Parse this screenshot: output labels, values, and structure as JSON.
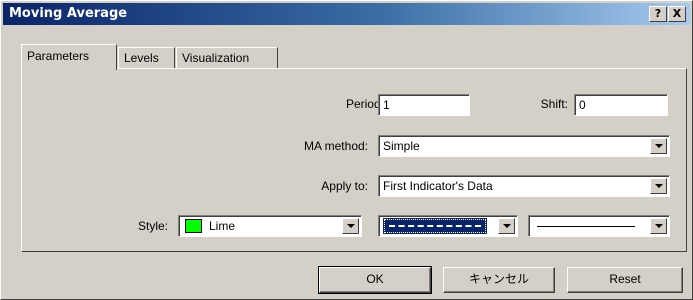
{
  "window": {
    "title": "Moving Average",
    "help_button": "?",
    "close_button": "X"
  },
  "tabs": [
    {
      "label": "Parameters",
      "active": true
    },
    {
      "label": "Levels",
      "active": false
    },
    {
      "label": "Visualization",
      "active": false
    }
  ],
  "params": {
    "period_label": "Period:",
    "period_value": "1",
    "shift_label": "Shift:",
    "shift_value": "0",
    "ma_method_label": "MA method:",
    "ma_method_value": "Simple",
    "apply_to_label": "Apply to:",
    "apply_to_value": "First Indicator's Data",
    "style_label": "Style:",
    "color_value": "Lime",
    "color_hex": "#00ff00",
    "line_style": "dash-dot",
    "line_width": "thin-solid"
  },
  "buttons": {
    "ok": "OK",
    "cancel": "キャンセル",
    "reset": "Reset"
  },
  "colors": {
    "title_gradient_start": "#0a246a",
    "dialog_bg": "#d4d0c8",
    "selection": "#0a246a"
  }
}
